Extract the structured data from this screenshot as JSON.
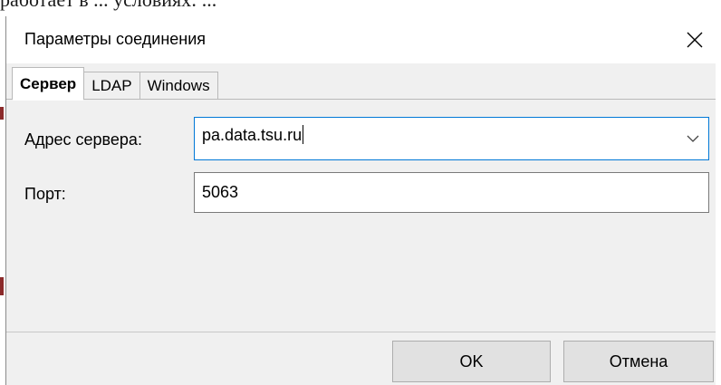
{
  "background": {
    "cropped_text": "работает в ... условиях: ..."
  },
  "dialog": {
    "title": "Параметры соединения",
    "close_icon": "close-icon",
    "tabs": [
      {
        "label": "Сервер",
        "active": true
      },
      {
        "label": "LDAP",
        "active": false
      },
      {
        "label": "Windows",
        "active": false
      }
    ],
    "server": {
      "label": "Адрес сервера:",
      "value": "pa.data.tsu.ru",
      "dropdown_icon": "chevron-down-icon"
    },
    "port": {
      "label": "Порт:",
      "value": "5063"
    },
    "buttons": {
      "ok": "OK",
      "cancel": "Отмена"
    },
    "colors": {
      "focus_border": "#0078d7",
      "dialog_bg": "#f0f0f0",
      "button_bg": "#e1e1e1"
    }
  }
}
